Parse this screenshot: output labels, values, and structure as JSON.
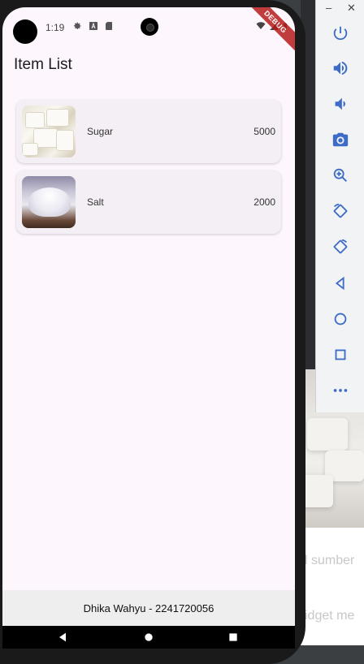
{
  "status_bar": {
    "time": "1:19",
    "debug_banner": "DEBUG"
  },
  "app": {
    "title": "Item List",
    "items": [
      {
        "name": "Sugar",
        "price": "5000",
        "image": "sugar-image"
      },
      {
        "name": "Salt",
        "price": "2000",
        "image": "salt-image"
      }
    ],
    "footer": "Dhika Wahyu - 2241720056"
  },
  "background_doc": {
    "line1": "l sumber",
    "line2": "idget me"
  },
  "emulator_toolbar": {
    "minimize": "–",
    "close": "✕",
    "buttons": [
      "power-icon",
      "volume-up-icon",
      "volume-down-icon",
      "camera-icon",
      "zoom-icon",
      "rotate-left-icon",
      "rotate-right-icon",
      "back-icon",
      "home-icon",
      "overview-icon",
      "more-icon"
    ]
  },
  "colors": {
    "screen_bg": "#fdf6fc",
    "card_bg": "#f4eef5",
    "footer_bg": "#eeeeee",
    "toolbar_icon": "#3c6cc8",
    "debug_ribbon": "#b71c1c"
  }
}
